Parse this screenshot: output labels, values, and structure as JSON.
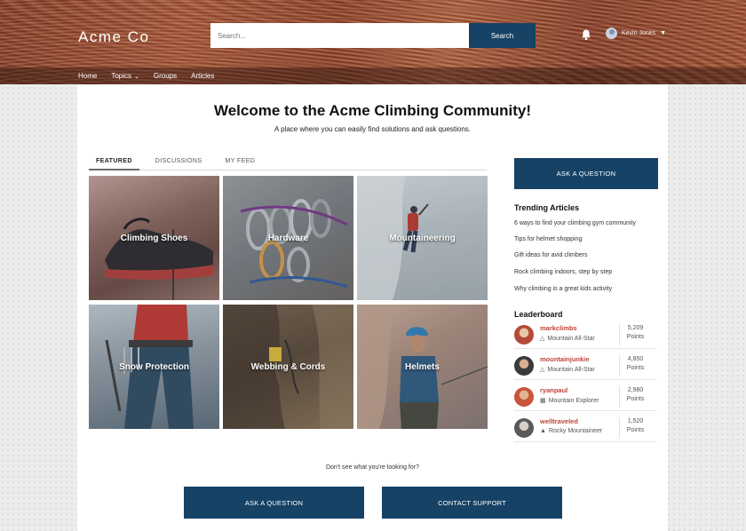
{
  "header": {
    "brand": "Acme Co",
    "search": {
      "placeholder": "Search...",
      "button_label": "Search"
    },
    "user": {
      "name": "Kevin Jones"
    },
    "nav": [
      {
        "label": "Home"
      },
      {
        "label": "Topics"
      },
      {
        "label": "Groups"
      },
      {
        "label": "Articles"
      }
    ]
  },
  "main": {
    "title": "Welcome to the Acme Climbing Community!",
    "subtitle": "A place where you can easily find solutions and ask questions.",
    "tabs": [
      {
        "label": "FEATURED",
        "active": true
      },
      {
        "label": "DISCUSSIONS",
        "active": false
      },
      {
        "label": "MY FEED",
        "active": false
      }
    ],
    "tiles": [
      {
        "label": "Climbing Shoes"
      },
      {
        "label": "Hardware"
      },
      {
        "label": "Mountaineering"
      },
      {
        "label": "Snow Protection"
      },
      {
        "label": "Webbing & Cords"
      },
      {
        "label": "Helmets"
      }
    ],
    "bottom_prompt": "Don't see what you're looking for?",
    "bottom_buttons": [
      {
        "label": "ASK A QUESTION"
      },
      {
        "label": "CONTACT SUPPORT"
      }
    ]
  },
  "sidebar": {
    "ask_button": "ASK A QUESTION",
    "trending_title": "Trending Articles",
    "trending": [
      "6 ways to find your climbing gym community",
      "Tips for helmet shopping",
      "Gift ideas for avid climbers",
      "Rock climbing indoors, step by step",
      "Why climbing is a great kids activity"
    ],
    "leaderboard_title": "Leaderboard",
    "leaders": [
      {
        "name": "markclimbs",
        "rank": "Mountain All-Star",
        "points": "5,209",
        "points_label": "Points"
      },
      {
        "name": "mountainjunkie",
        "rank": "Mountain All-Star",
        "points": "4,850",
        "points_label": "Points"
      },
      {
        "name": "ryanpaul",
        "rank": "Mountain Explorer",
        "points": "2,980",
        "points_label": "Points"
      },
      {
        "name": "welltraveled",
        "rank": "Rocky Mountaineer",
        "points": "1,520",
        "points_label": "Points"
      }
    ]
  },
  "colors": {
    "primary": "#164266",
    "leader_name": "#c0433a"
  }
}
